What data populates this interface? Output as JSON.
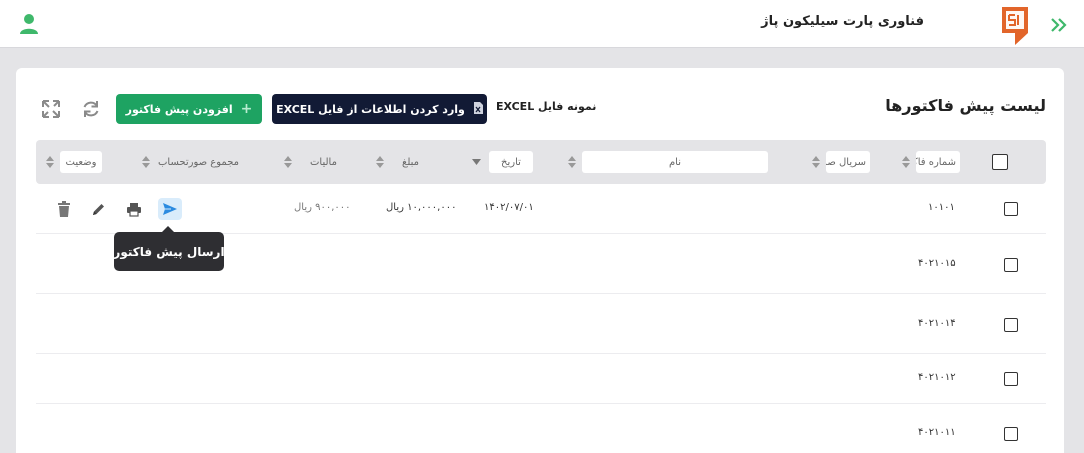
{
  "header": {
    "brand_name": "فناوری پارت سیلیکون پاژ",
    "brand_logo_text": "S",
    "icons": {
      "collapse": "double-chevron-right-icon",
      "user": "user-icon"
    }
  },
  "page": {
    "title": "لیست پیش فاکتورها",
    "sample_file_label": "نمونه فایل EXCEL",
    "import_button_label": "وارد کردن اطلاعات از فایل EXCEL",
    "add_button_label": "افزودن پیش فاکتور",
    "add_button_plus": "+"
  },
  "table": {
    "columns": {
      "invoice_number": "شماره فاک",
      "serial": "سریال صو",
      "name": "نام",
      "date": "تاریخ",
      "amount": "مبلغ",
      "tax": "مالیات",
      "total": "مجموع صورتحساب",
      "status": "وضعیت"
    },
    "rows": [
      {
        "invoice_number": "۱۰۱۰۱",
        "date": "۱۴۰۲/۰۷/۰۱",
        "amount": "۱۰,۰۰۰,۰۰۰ ریال",
        "tax": "۹۰۰,۰۰۰ ریال"
      },
      {
        "invoice_number": "۴۰۲۱۰۱۵"
      },
      {
        "invoice_number": "۴۰۲۱۰۱۴"
      },
      {
        "invoice_number": "۴۰۲۱۰۱۲"
      },
      {
        "invoice_number": "۴۰۲۱۰۱۱"
      }
    ]
  },
  "tooltip": {
    "text": "ارسال پیش فاکتور"
  },
  "colors": {
    "primary_dark": "#121a35",
    "success": "#1ea362",
    "send_highlight": "#d9ecfb",
    "tooltip_bg": "#2e2e32",
    "brand_orange": "#e2652a"
  }
}
